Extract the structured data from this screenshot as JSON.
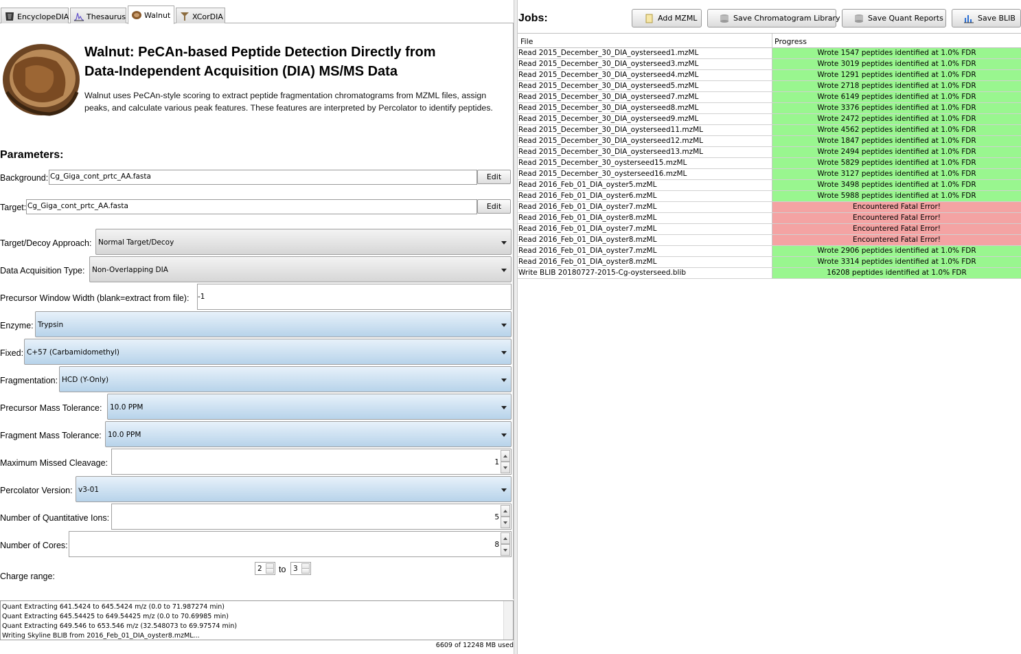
{
  "tabs": [
    {
      "label": "EncyclopeDIA",
      "icon": "encyclopedia-icon"
    },
    {
      "label": "Thesaurus",
      "icon": "thesaurus-icon"
    },
    {
      "label": "Walnut",
      "icon": "walnut-icon",
      "active": true
    },
    {
      "label": "XCorDIA",
      "icon": "xcordia-icon"
    }
  ],
  "header": {
    "title_line1": "Walnut: PeCAn-based Peptide Detection Directly from",
    "title_line2": "Data-Independent Acquisition (DIA) MS/MS Data",
    "description": "Walnut uses PeCAn-style scoring to extract peptide fragmentation chromatograms from MZML files, assign peaks, and calculate various peak features. These features are interpreted by Percolator to identify peptides."
  },
  "params": {
    "heading": "Parameters:",
    "background_label": "Background:",
    "background_value": "Cg_Giga_cont_prtc_AA.fasta",
    "target_label": "Target:",
    "target_value": "Cg_Giga_cont_prtc_AA.fasta",
    "edit_label": "Edit",
    "decoy_label": "Target/Decoy Approach:",
    "decoy_value": "Normal Target/Decoy",
    "acq_label": "Data Acquisition Type:",
    "acq_value": "Non-Overlapping DIA",
    "window_label": "Precursor Window Width (blank=extract from file):",
    "window_value": "-1",
    "enzyme_label": "Enzyme:",
    "enzyme_value": "Trypsin",
    "fixed_label": "Fixed:",
    "fixed_value": "C+57 (Carbamidomethyl)",
    "frag_label": "Fragmentation:",
    "frag_value": "HCD (Y-Only)",
    "prec_tol_label": "Precursor Mass Tolerance:",
    "prec_tol_value": "10.0 PPM",
    "frag_tol_label": "Fragment Mass Tolerance:",
    "frag_tol_value": "10.0 PPM",
    "missed_label": "Maximum Missed Cleavage:",
    "missed_value": "1",
    "perc_label": "Percolator Version:",
    "perc_value": "v3-01",
    "quant_label": "Number of Quantitative Ions:",
    "quant_value": "5",
    "cores_label": "Number of Cores:",
    "cores_value": "8",
    "charge_label": "Charge range:",
    "charge_min": "2",
    "charge_to": "to",
    "charge_max": "3"
  },
  "log": [
    "Quant Extracting 641.5424 to 645.5424 m/z (0.0 to 71.987274 min)",
    "Quant Extracting 645.54425 to 649.54425 m/z (0.0 to 70.69985 min)",
    "Quant Extracting 649.546 to 653.546 m/z (32.548073 to 69.97574 min)",
    "Writing Skyline BLIB from 2016_Feb_01_DIA_oyster8.mzML..."
  ],
  "memory": "6609 of 12248 MB used",
  "jobs": {
    "title": "Jobs:",
    "buttons": [
      {
        "label": "Add MZML",
        "icon": "file-add-icon"
      },
      {
        "label": "Save Chromatogram Library",
        "icon": "database-icon"
      },
      {
        "label": "Save Quant Reports",
        "icon": "database-icon"
      },
      {
        "label": "Save BLIB",
        "icon": "chart-icon"
      }
    ],
    "col_file": "File",
    "col_progress": "Progress",
    "rows": [
      {
        "file": "Read 2015_December_30_DIA_oysterseed1.mzML",
        "progress": "Wrote 1547 peptides identified at 1.0% FDR",
        "status": "ok"
      },
      {
        "file": "Read 2015_December_30_DIA_oysterseed3.mzML",
        "progress": "Wrote 3019 peptides identified at 1.0% FDR",
        "status": "ok"
      },
      {
        "file": "Read 2015_December_30_DIA_oysterseed4.mzML",
        "progress": "Wrote 1291 peptides identified at 1.0% FDR",
        "status": "ok"
      },
      {
        "file": "Read 2015_December_30_DIA_oysterseed5.mzML",
        "progress": "Wrote 2718 peptides identified at 1.0% FDR",
        "status": "ok"
      },
      {
        "file": "Read 2015_December_30_DIA_oysterseed7.mzML",
        "progress": "Wrote 6149 peptides identified at 1.0% FDR",
        "status": "ok"
      },
      {
        "file": "Read 2015_December_30_DIA_oysterseed8.mzML",
        "progress": "Wrote 3376 peptides identified at 1.0% FDR",
        "status": "ok"
      },
      {
        "file": "Read 2015_December_30_DIA_oysterseed9.mzML",
        "progress": "Wrote 2472 peptides identified at 1.0% FDR",
        "status": "ok"
      },
      {
        "file": "Read 2015_December_30_DIA_oysterseed11.mzML",
        "progress": "Wrote 4562 peptides identified at 1.0% FDR",
        "status": "ok"
      },
      {
        "file": "Read 2015_December_30_DIA_oysterseed12.mzML",
        "progress": "Wrote 1847 peptides identified at 1.0% FDR",
        "status": "ok"
      },
      {
        "file": "Read 2015_December_30_DIA_oysterseed13.mzML",
        "progress": "Wrote 2494 peptides identified at 1.0% FDR",
        "status": "ok"
      },
      {
        "file": "Read 2015_December_30_oysterseed15.mzML",
        "progress": "Wrote 5829 peptides identified at 1.0% FDR",
        "status": "ok"
      },
      {
        "file": "Read 2015_December_30_oysterseed16.mzML",
        "progress": "Wrote 3127 peptides identified at 1.0% FDR",
        "status": "ok"
      },
      {
        "file": "Read 2016_Feb_01_DIA_oyster5.mzML",
        "progress": "Wrote 3498 peptides identified at 1.0% FDR",
        "status": "ok"
      },
      {
        "file": "Read 2016_Feb_01_DIA_oyster6.mzML",
        "progress": "Wrote 5988 peptides identified at 1.0% FDR",
        "status": "ok"
      },
      {
        "file": "Read 2016_Feb_01_DIA_oyster7.mzML",
        "progress": "Encountered Fatal Error!",
        "status": "err"
      },
      {
        "file": "Read 2016_Feb_01_DIA_oyster8.mzML",
        "progress": "Encountered Fatal Error!",
        "status": "err"
      },
      {
        "file": "Read 2016_Feb_01_DIA_oyster7.mzML",
        "progress": "Encountered Fatal Error!",
        "status": "err"
      },
      {
        "file": "Read 2016_Feb_01_DIA_oyster8.mzML",
        "progress": "Encountered Fatal Error!",
        "status": "err"
      },
      {
        "file": "Read 2016_Feb_01_DIA_oyster7.mzML",
        "progress": "Wrote 2906 peptides identified at 1.0% FDR",
        "status": "ok"
      },
      {
        "file": "Read 2016_Feb_01_DIA_oyster8.mzML",
        "progress": "Wrote 3314 peptides identified at 1.0% FDR",
        "status": "ok"
      },
      {
        "file": "Write BLIB 20180727-2015-Cg-oysterseed.blib",
        "progress": "16208 peptides identified at 1.0% FDR",
        "status": "ok"
      }
    ]
  },
  "colors": {
    "ok": "#99f68f",
    "err": "#f4a3a3",
    "combo_blue": "#b7d3ea"
  }
}
